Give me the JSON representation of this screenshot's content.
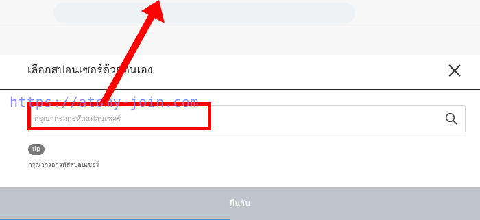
{
  "modal": {
    "title": "เลือกสปอนเซอร์ด้วยตนเอง",
    "close_label": "close",
    "search": {
      "placeholder": "กรุณากรอกรหัสสปอนเซอร์",
      "value": ""
    },
    "tip": {
      "badge": "tip",
      "text": "กรุณากรอกรหัสสปอนเซอร์"
    },
    "confirm_label": "ยืนยัน"
  },
  "watermark": "https://atomy-join.com",
  "icons": {
    "close": "close-icon",
    "search": "search-icon",
    "arrow": "arrow-annotation-icon"
  },
  "colors": {
    "annotation_red": "#ff0000",
    "confirm_disabled": "#bfc5cb",
    "watermark": "#7d7cf2",
    "tip_badge": "#7a7a7a",
    "accent_blue": "#3c8fd6"
  }
}
